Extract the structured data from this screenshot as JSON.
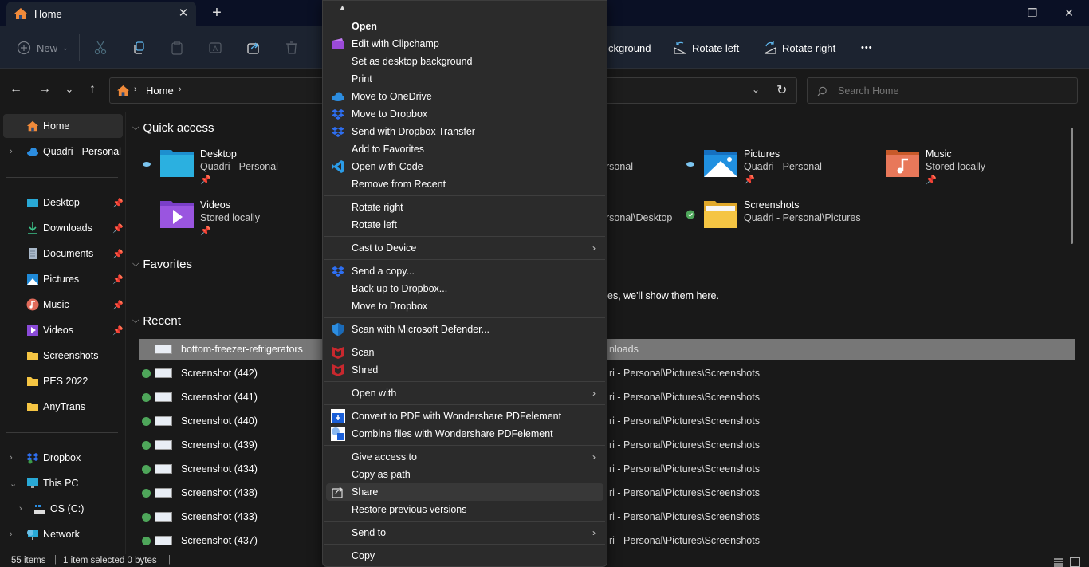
{
  "window": {
    "tab_title": "Home",
    "tab_close": "✕",
    "new_tab": "+",
    "minimize": "—",
    "maximize": "❐",
    "close": "✕"
  },
  "toolbar": {
    "new_label": "New",
    "set_background_partial": "ckground",
    "rotate_left": "Rotate left",
    "rotate_right": "Rotate right",
    "more": "•••"
  },
  "nav": {
    "back": "←",
    "forward": "→",
    "recent": "⌄",
    "up": "↑",
    "breadcrumb": [
      "Home"
    ],
    "refresh": "↻",
    "search_placeholder": "Search Home"
  },
  "sidebar": {
    "top": [
      {
        "label": "Home",
        "selected": true
      },
      {
        "label": "Quadri - Personal",
        "expandable": true
      }
    ],
    "pinned": [
      {
        "label": "Desktop",
        "pinned": true
      },
      {
        "label": "Downloads",
        "pinned": true
      },
      {
        "label": "Documents",
        "pinned": true
      },
      {
        "label": "Pictures",
        "pinned": true
      },
      {
        "label": "Music",
        "pinned": true
      },
      {
        "label": "Videos",
        "pinned": true
      },
      {
        "label": "Screenshots"
      },
      {
        "label": "PES 2022"
      },
      {
        "label": "AnyTrans"
      }
    ],
    "drives": [
      {
        "label": "Dropbox",
        "chevron": "›"
      },
      {
        "label": "This PC",
        "chevron": "⌄"
      },
      {
        "label": "OS (C:)",
        "chevron": "›"
      },
      {
        "label": "Network",
        "chevron": "›"
      }
    ]
  },
  "main": {
    "quick_access_title": "Quick access",
    "favorites_title": "Favorites",
    "recent_title": "Recent",
    "favorites_empty_partial": "es, we'll show them here.",
    "quick_access": [
      {
        "name": "Desktop",
        "sub": "Quadri - Personal",
        "status": "cloud",
        "pinned": true
      },
      {
        "name": "Videos",
        "sub": "Stored locally",
        "status": "none",
        "pinned": true
      },
      {
        "name": "",
        "sub_partial": "rsonal",
        "status": "none"
      },
      {
        "name": "",
        "sub_partial": "rsonal\\Desktop",
        "status": "none"
      },
      {
        "name": "Pictures",
        "sub": "Quadri - Personal",
        "status": "cloud",
        "pinned": true
      },
      {
        "name": "Screenshots",
        "sub": "Quadri - Personal\\Pictures",
        "status": "synced",
        "pinned": false
      },
      {
        "name": "Music",
        "sub": "Stored locally",
        "status": "none",
        "pinned": true
      }
    ],
    "recent": [
      {
        "name": "bottom-freezer-refrigerators",
        "location_partial": "nloads",
        "selected": true
      },
      {
        "name": "Screenshot (442)",
        "location_partial": "ri - Personal\\Pictures\\Screenshots"
      },
      {
        "name": "Screenshot (441)",
        "location_partial": "ri - Personal\\Pictures\\Screenshots"
      },
      {
        "name": "Screenshot (440)",
        "location_partial": "ri - Personal\\Pictures\\Screenshots"
      },
      {
        "name": "Screenshot (439)",
        "location_partial": "ri - Personal\\Pictures\\Screenshots"
      },
      {
        "name": "Screenshot (434)",
        "location_partial": "ri - Personal\\Pictures\\Screenshots"
      },
      {
        "name": "Screenshot (438)",
        "location_partial": "ri - Personal\\Pictures\\Screenshots"
      },
      {
        "name": "Screenshot (433)",
        "location_partial": "ri - Personal\\Pictures\\Screenshots"
      },
      {
        "name": "Screenshot (437)",
        "location_partial": "ri - Personal\\Pictures\\Screenshots"
      }
    ]
  },
  "status_bar": {
    "items": "55 items",
    "selection": "1 item selected  0 bytes"
  },
  "context_menu": {
    "scroll_up": "▲",
    "items": [
      {
        "label": "Open",
        "bold": true
      },
      {
        "label": "Edit with Clipchamp",
        "icon": "clipchamp-icon"
      },
      {
        "label": "Set as desktop background"
      },
      {
        "label": "Print"
      },
      {
        "label": "Move to OneDrive",
        "icon": "onedrive-icon"
      },
      {
        "label": "Move to Dropbox",
        "icon": "dropbox-icon"
      },
      {
        "label": "Send with Dropbox Transfer",
        "icon": "dropbox-icon"
      },
      {
        "label": "Add to Favorites"
      },
      {
        "label": "Open with Code",
        "icon": "vscode-icon"
      },
      {
        "label": "Remove from Recent"
      },
      {
        "label": "Rotate right"
      },
      {
        "label": "Rotate left"
      },
      {
        "label": "Cast to Device",
        "submenu": true
      },
      {
        "label": "Send a copy...",
        "icon": "dropbox-icon"
      },
      {
        "label": "Back up to Dropbox..."
      },
      {
        "label": "Move to Dropbox"
      },
      {
        "label": "Scan with Microsoft Defender...",
        "icon": "defender-icon"
      },
      {
        "label": "Scan",
        "icon": "mcafee-icon"
      },
      {
        "label": "Shred",
        "icon": "mcafee-icon"
      },
      {
        "label": "Open with",
        "submenu": true
      },
      {
        "label": "Convert to PDF with Wondershare PDFelement",
        "icon": "pdfelement-icon"
      },
      {
        "label": "Combine files with Wondershare PDFelement",
        "icon": "pdfelement-combine-icon"
      },
      {
        "label": "Give access to",
        "submenu": true
      },
      {
        "label": "Copy as path"
      },
      {
        "label": "Share",
        "icon": "share-icon",
        "highlighted": true
      },
      {
        "label": "Restore previous versions"
      },
      {
        "label": "Send to",
        "submenu": true
      },
      {
        "label": "Copy"
      }
    ],
    "submenu_arrow": "›"
  },
  "colors": {
    "titlebar": "#0a1025",
    "toolbar": "#1c2330",
    "background": "#191919",
    "menu": "#2b2b2b",
    "selected_row": "#777777",
    "sync_green": "#4ea65a",
    "folder_yellow": "#f5c543"
  }
}
